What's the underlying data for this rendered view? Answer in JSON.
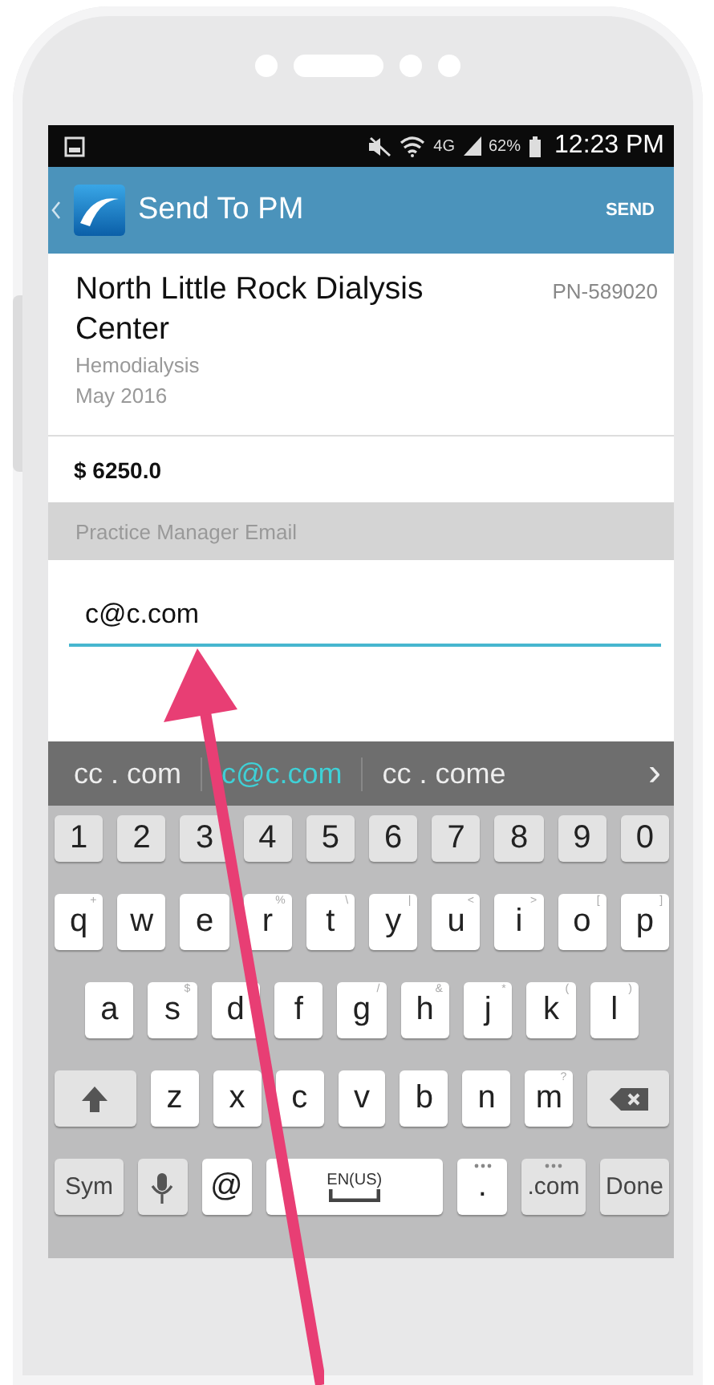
{
  "status_bar": {
    "network": "4G",
    "battery": "62%",
    "time": "12:23 PM"
  },
  "app_bar": {
    "title": "Send To PM",
    "action": "SEND"
  },
  "record": {
    "title": "North Little Rock Dialysis Center",
    "code": "PN-589020",
    "type": "Hemodialysis",
    "date": "May 2016",
    "amount": "$ 6250.0"
  },
  "section_header": "Practice Manager Email",
  "email_field": {
    "value": "c@c.com",
    "focused": true
  },
  "suggestions": [
    {
      "label": "cc . com",
      "selected": false
    },
    {
      "label": "c@c.com",
      "selected": true
    },
    {
      "label": "cc . come",
      "selected": false
    }
  ],
  "suggestions_more": "›",
  "keyboard": {
    "rows": [
      {
        "keys": [
          {
            "kind": "num",
            "label": "1"
          },
          {
            "kind": "num",
            "label": "2"
          },
          {
            "kind": "num",
            "label": "3"
          },
          {
            "kind": "num",
            "label": "4"
          },
          {
            "kind": "num",
            "label": "5"
          },
          {
            "kind": "num",
            "label": "6"
          },
          {
            "kind": "num",
            "label": "7"
          },
          {
            "kind": "num",
            "label": "8"
          },
          {
            "kind": "num",
            "label": "9"
          },
          {
            "kind": "num",
            "label": "0"
          }
        ]
      },
      {
        "keys": [
          {
            "kind": "letter",
            "label": "q",
            "hint": "+"
          },
          {
            "kind": "letter",
            "label": "w"
          },
          {
            "kind": "letter",
            "label": "e"
          },
          {
            "kind": "letter",
            "label": "r",
            "hint": "%"
          },
          {
            "kind": "letter",
            "label": "t",
            "hint": "\\"
          },
          {
            "kind": "letter",
            "label": "y",
            "hint": "|"
          },
          {
            "kind": "letter",
            "label": "u",
            "hint": "<"
          },
          {
            "kind": "letter",
            "label": "i",
            "hint": ">"
          },
          {
            "kind": "letter",
            "label": "o",
            "hint": "["
          },
          {
            "kind": "letter",
            "label": "p",
            "hint": "]"
          }
        ]
      },
      {
        "keys": [
          {
            "kind": "letter",
            "label": "a"
          },
          {
            "kind": "letter",
            "label": "s",
            "hint": "$"
          },
          {
            "kind": "letter",
            "label": "d"
          },
          {
            "kind": "letter",
            "label": "f"
          },
          {
            "kind": "letter",
            "label": "g",
            "hint": "/"
          },
          {
            "kind": "letter",
            "label": "h",
            "hint": "&"
          },
          {
            "kind": "letter",
            "label": "j",
            "hint": "*"
          },
          {
            "kind": "letter",
            "label": "k",
            "hint": "("
          },
          {
            "kind": "letter",
            "label": "l",
            "hint": ")"
          }
        ]
      },
      {
        "keys": [
          {
            "kind": "shift"
          },
          {
            "kind": "letter",
            "label": "z"
          },
          {
            "kind": "letter",
            "label": "x"
          },
          {
            "kind": "letter",
            "label": "c"
          },
          {
            "kind": "letter",
            "label": "v"
          },
          {
            "kind": "letter",
            "label": "b"
          },
          {
            "kind": "letter",
            "label": "n"
          },
          {
            "kind": "letter",
            "label": "m",
            "hint": "?"
          },
          {
            "kind": "backspace"
          }
        ]
      },
      {
        "keys": [
          {
            "kind": "func",
            "label": "Sym"
          },
          {
            "kind": "mic"
          },
          {
            "kind": "letter",
            "label": "@"
          },
          {
            "kind": "space",
            "label": "EN(US)"
          },
          {
            "kind": "period",
            "label": "."
          },
          {
            "kind": "dotcom",
            "label": ".com"
          },
          {
            "kind": "func",
            "label": "Done"
          }
        ]
      }
    ]
  }
}
